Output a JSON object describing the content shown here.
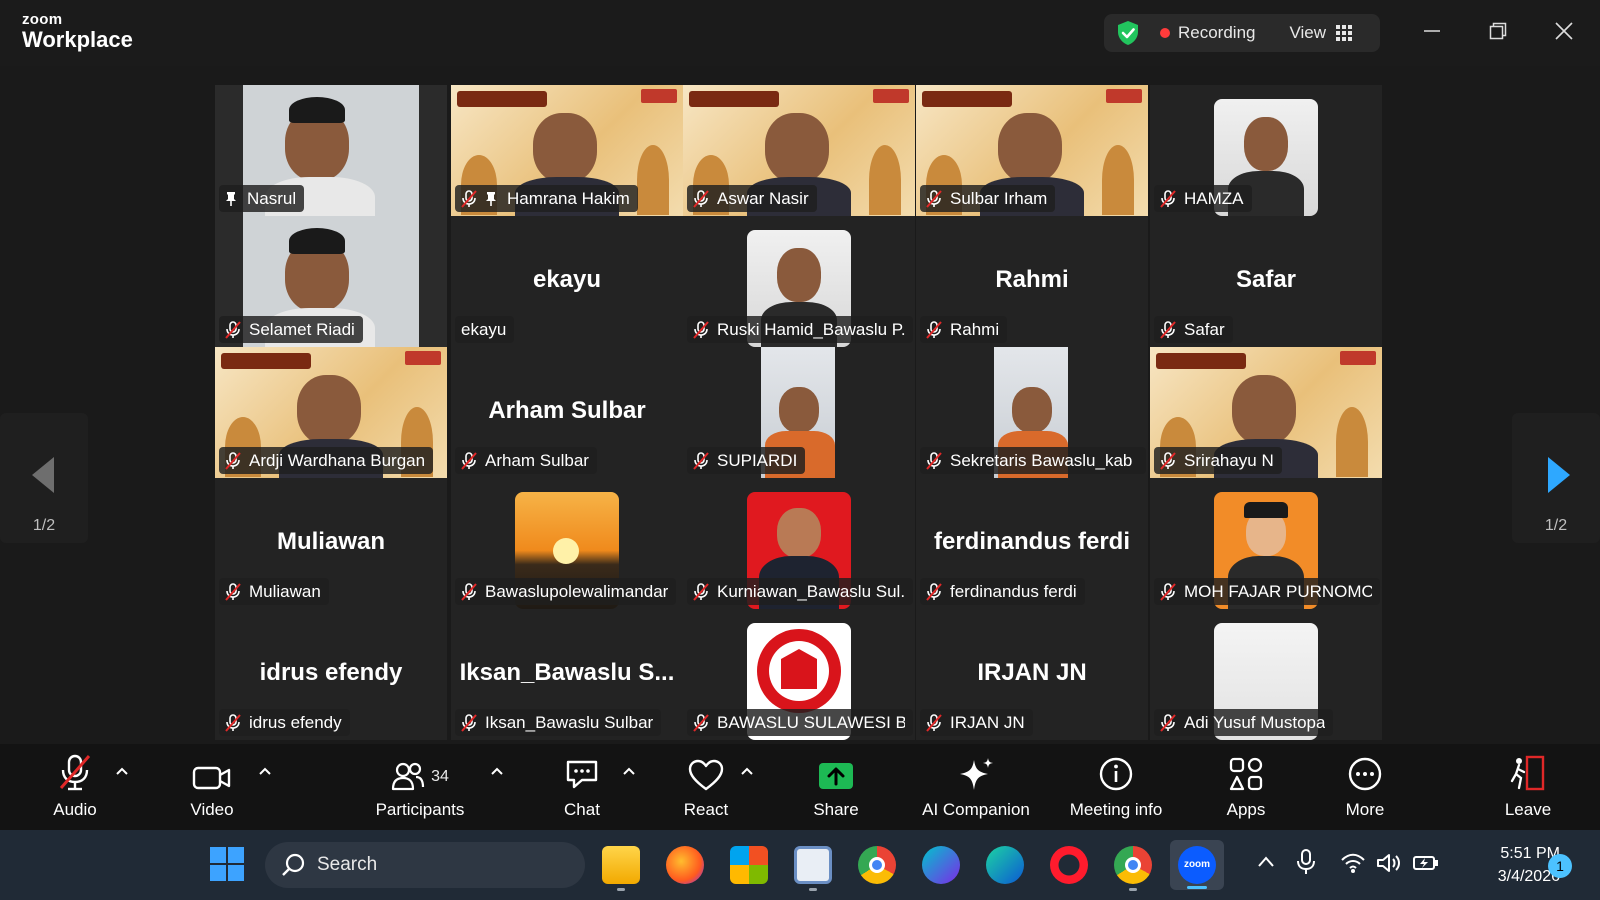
{
  "app": {
    "brand_top": "zoom",
    "brand_bottom": "Workplace"
  },
  "header": {
    "recording_label": "Recording",
    "view_label": "View"
  },
  "pager": {
    "left_page": "1/2",
    "right_page": "1/2"
  },
  "participants": [
    {
      "display": "Nasrul",
      "big_name": "",
      "video": "camera",
      "pinned": true,
      "muted": false,
      "active": true
    },
    {
      "display": "Hamrana Hakim",
      "big_name": "",
      "video": "ngabuburit",
      "pinned": true,
      "muted": true
    },
    {
      "display": "Aswar Nasir",
      "big_name": "",
      "video": "ngabuburit",
      "muted": true
    },
    {
      "display": "Sulbar Irham",
      "big_name": "",
      "video": "ngabuburit",
      "muted": true
    },
    {
      "display": "HAMZA",
      "big_name": "",
      "video": "avatar",
      "muted": true
    },
    {
      "display": "Selamet Riadi",
      "big_name": "",
      "video": "camera",
      "muted": true
    },
    {
      "display": "ekayu",
      "big_name": "ekayu",
      "video": "none",
      "muted": false
    },
    {
      "display": "Ruski Hamid_Bawaslu P...",
      "big_name": "",
      "video": "avatar",
      "muted": true
    },
    {
      "display": "Rahmi",
      "big_name": "Rahmi",
      "video": "none",
      "muted": true
    },
    {
      "display": "Safar",
      "big_name": "Safar",
      "video": "none",
      "muted": true
    },
    {
      "display": "Ardji Wardhana Burgan",
      "big_name": "",
      "video": "ngabuburit",
      "muted": true
    },
    {
      "display": "Arham Sulbar",
      "big_name": "Arham Sulbar",
      "video": "none",
      "muted": true
    },
    {
      "display": "SUPIARDI",
      "big_name": "",
      "video": "camera-narrow",
      "muted": true
    },
    {
      "display": "Sekretaris Bawaslu_kab ...",
      "big_name": "",
      "video": "camera-narrow",
      "muted": true
    },
    {
      "display": "Srirahayu N",
      "big_name": "",
      "video": "ngabuburit",
      "muted": true
    },
    {
      "display": "Muliawan",
      "big_name": "Muliawan",
      "video": "none",
      "muted": true
    },
    {
      "display": "Bawaslupolewalimandar",
      "big_name": "",
      "video": "sunset",
      "muted": true
    },
    {
      "display": "Kurniawan_Bawaslu Sul...",
      "big_name": "",
      "video": "red-avatar",
      "muted": true
    },
    {
      "display": "ferdinandus ferdi",
      "big_name": "ferdinandus ferdi",
      "video": "none",
      "muted": true
    },
    {
      "display": "MOH FAJAR PURNOMO",
      "big_name": "",
      "video": "orange-avatar",
      "muted": true
    },
    {
      "display": "idrus efendy",
      "big_name": "idrus efendy",
      "video": "none",
      "muted": true
    },
    {
      "display": "Iksan_Bawaslu Sulbar",
      "big_name": "Iksan_Bawaslu  S...",
      "video": "none",
      "muted": true
    },
    {
      "display": "BAWASLU SULAWESI B...",
      "big_name": "",
      "video": "bawaslu-logo",
      "muted": true
    },
    {
      "display": "IRJAN JN",
      "big_name": "IRJAN JN",
      "video": "none",
      "muted": true
    },
    {
      "display": "Adi Yusuf Mustopa",
      "big_name": "",
      "video": "white-avatar",
      "muted": true
    }
  ],
  "toolbar": {
    "audio": "Audio",
    "video": "Video",
    "participants": "Participants",
    "participants_count": "34",
    "chat": "Chat",
    "react": "React",
    "share": "Share",
    "ai_companion": "AI Companion",
    "meeting_info": "Meeting info",
    "apps": "Apps",
    "more": "More",
    "leave": "Leave"
  },
  "taskbar": {
    "search_label": "Search",
    "time": "5:51 PM",
    "date": "3/4/2026",
    "notifications": "1"
  },
  "colors": {
    "active_speaker": "#27d38a",
    "share_green": "#1db954",
    "leave_red": "#e02828",
    "recording_dot": "#ff3b3b"
  }
}
